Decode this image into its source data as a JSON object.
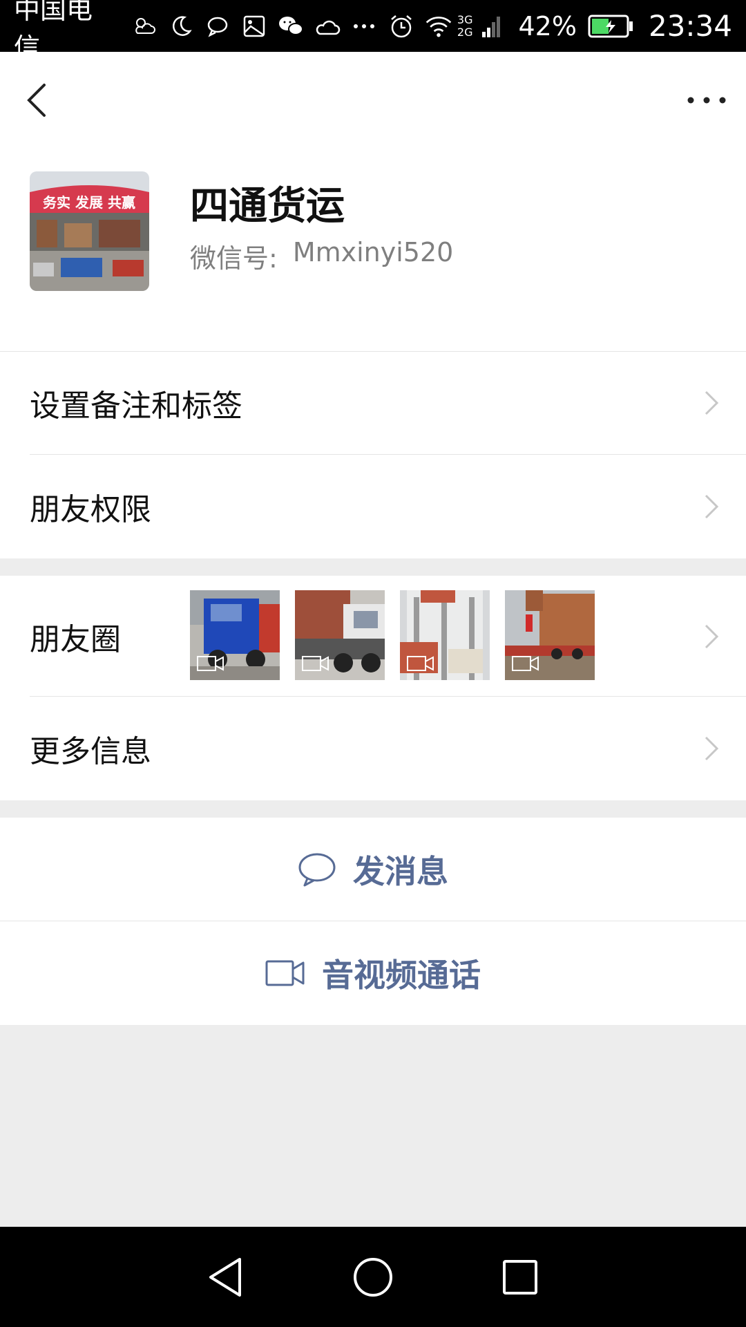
{
  "status_bar": {
    "carrier": "中国电信",
    "network_top": "3G",
    "network_bottom": "2G",
    "battery_percent": "42%",
    "time": "23:34",
    "icons": [
      "weather-icon",
      "moon-icon",
      "chat-bubble-icon",
      "image-icon",
      "wechat-icon",
      "cloud-icon",
      "more-dots-icon",
      "alarm-icon",
      "wifi-icon",
      "signal-icon",
      "battery-icon"
    ]
  },
  "header": {
    "back_icon": "back-arrow-icon",
    "more_icon": "more-horizontal-icon"
  },
  "profile": {
    "name": "四通货运",
    "wechat_id_label": "微信号:",
    "wechat_id_value": "Mmxinyi520",
    "avatar_banner_text": "务实 发展 共赢"
  },
  "settings_section": {
    "items": [
      {
        "label": "设置备注和标签"
      },
      {
        "label": "朋友权限"
      }
    ]
  },
  "moments_section": {
    "moments_label": "朋友圈",
    "thumbnail_count": 4,
    "more_info_label": "更多信息"
  },
  "actions": {
    "send_message": "发消息",
    "av_call": "音视频通话"
  },
  "colors": {
    "link": "#576b95",
    "background": "#ededed",
    "status_bar": "#000000",
    "battery_fill": "#4cd964"
  }
}
